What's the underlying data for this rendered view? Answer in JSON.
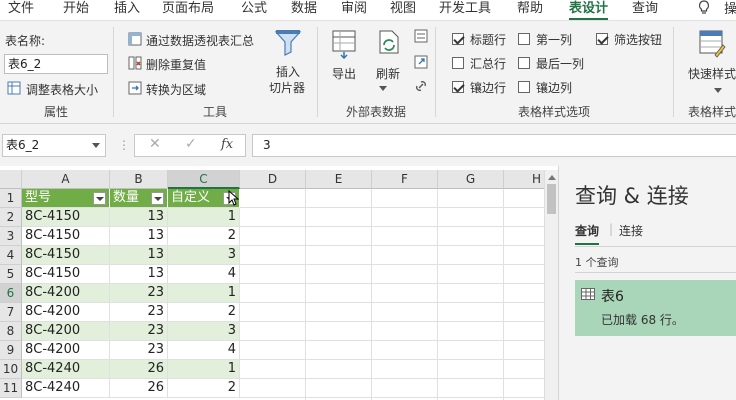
{
  "menu": {
    "items": [
      "文件",
      "开始",
      "插入",
      "页面布局",
      "公式",
      "数据",
      "审阅",
      "视图",
      "开发工具",
      "帮助",
      "表设计",
      "查询"
    ],
    "active_index": 10,
    "tell_me_partial": "操"
  },
  "ribbon": {
    "properties": {
      "table_name_label": "表名称:",
      "table_name_value": "表6_2",
      "resize_label": "调整表格大小",
      "group_label": "属性"
    },
    "tools": {
      "summarize_pivot": "通过数据透视表汇总",
      "remove_duplicates": "删除重复值",
      "convert_range": "转换为区域",
      "insert_slicer_line1": "插入",
      "insert_slicer_line2": "切片器",
      "group_label": "工具"
    },
    "external": {
      "export": "导出",
      "refresh": "刷新",
      "group_label": "外部表数据"
    },
    "style_options": {
      "header_row": {
        "label": "标题行",
        "checked": true
      },
      "total_row": {
        "label": "汇总行",
        "checked": false
      },
      "banded_rows": {
        "label": "镶边行",
        "checked": true
      },
      "first_column": {
        "label": "第一列",
        "checked": false
      },
      "last_column": {
        "label": "最后一列",
        "checked": false
      },
      "banded_columns": {
        "label": "镶边列",
        "checked": false
      },
      "filter_button": {
        "label": "筛选按钮",
        "checked": true
      },
      "group_label": "表格样式选项"
    },
    "table_styles": {
      "quick_styles": "快速样式",
      "group_label": "表格样式"
    }
  },
  "formula_bar": {
    "name_box": "表6_2",
    "cancel_glyph": "✕",
    "enter_glyph": "✓",
    "fx_label": "fx",
    "value": "3"
  },
  "sheet": {
    "columns": [
      "A",
      "B",
      "C",
      "D",
      "E",
      "F",
      "G",
      "H"
    ],
    "selected_column": "C",
    "row_numbers": [
      "1",
      "2",
      "3",
      "4",
      "5",
      "6",
      "7",
      "8",
      "9",
      "10",
      "11"
    ],
    "selected_row": "6",
    "table_headers": [
      "型号",
      "数量",
      "自定义"
    ],
    "rows": [
      [
        "8C-4150",
        "13",
        "1"
      ],
      [
        "8C-4150",
        "13",
        "2"
      ],
      [
        "8C-4150",
        "13",
        "3"
      ],
      [
        "8C-4150",
        "13",
        "4"
      ],
      [
        "8C-4200",
        "23",
        "1"
      ],
      [
        "8C-4200",
        "23",
        "2"
      ],
      [
        "8C-4200",
        "23",
        "3"
      ],
      [
        "8C-4200",
        "23",
        "4"
      ],
      [
        "8C-4240",
        "26",
        "1"
      ],
      [
        "8C-4240",
        "26",
        "2"
      ]
    ],
    "colors": {
      "header_fill": "#70ad47",
      "band_fill": "#e2efda",
      "accent": "#217346"
    }
  },
  "query_pane": {
    "title": "查询 & 连接",
    "tabs": [
      "查询",
      "连接"
    ],
    "active_tab": 0,
    "count_text": "1 个查询",
    "query_name": "表6",
    "query_status": "已加载 68 行。",
    "card_color": "#a9d5b8"
  }
}
